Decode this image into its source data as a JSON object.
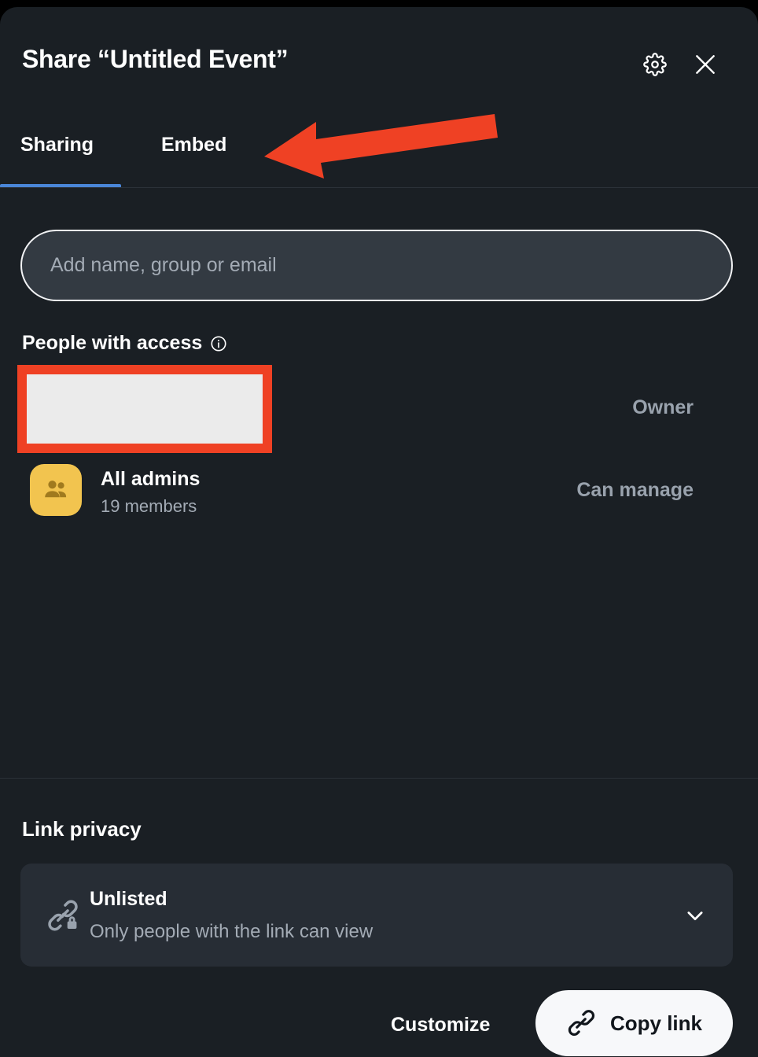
{
  "dialog": {
    "title": "Share “Untitled Event”",
    "settings_icon": "gear-icon",
    "close_icon": "close-icon"
  },
  "tabs": [
    {
      "label": "Sharing",
      "active": true
    },
    {
      "label": "Embed",
      "active": false
    }
  ],
  "share": {
    "add_input_placeholder": "Add name, group or email",
    "add_input_value": "",
    "section_title": "People with access",
    "info_icon": "info-icon",
    "rows": [
      {
        "name": "",
        "subtitle": "",
        "role": "Owner",
        "redacted": true
      },
      {
        "name": "All admins",
        "subtitle": "19 members",
        "role": "Can manage",
        "avatar_icon": "people-group-icon",
        "redacted": false
      }
    ]
  },
  "link_privacy": {
    "title": "Link privacy",
    "icon": "link-lock-icon",
    "option_name": "Unlisted",
    "option_description": "Only people with the link can view",
    "chevron_icon": "chevron-down-icon"
  },
  "footer": {
    "customize_label": "Customize",
    "copy_link_label": "Copy link",
    "copy_link_icon": "link-icon"
  },
  "annotation": {
    "arrow_color": "#ef4124",
    "arrow_points_to": "Embed",
    "highlight_color": "#ef4124"
  },
  "colors": {
    "background": "#1a1f24",
    "surface": "#272d35",
    "input_fill": "#333a42",
    "accent_tab": "#4a86d8",
    "avatar_amber": "#f2c44f",
    "text_primary": "#ffffff",
    "text_muted": "#a3abb5",
    "annotation_red": "#ef4124",
    "button_light": "#f7f8fa"
  }
}
